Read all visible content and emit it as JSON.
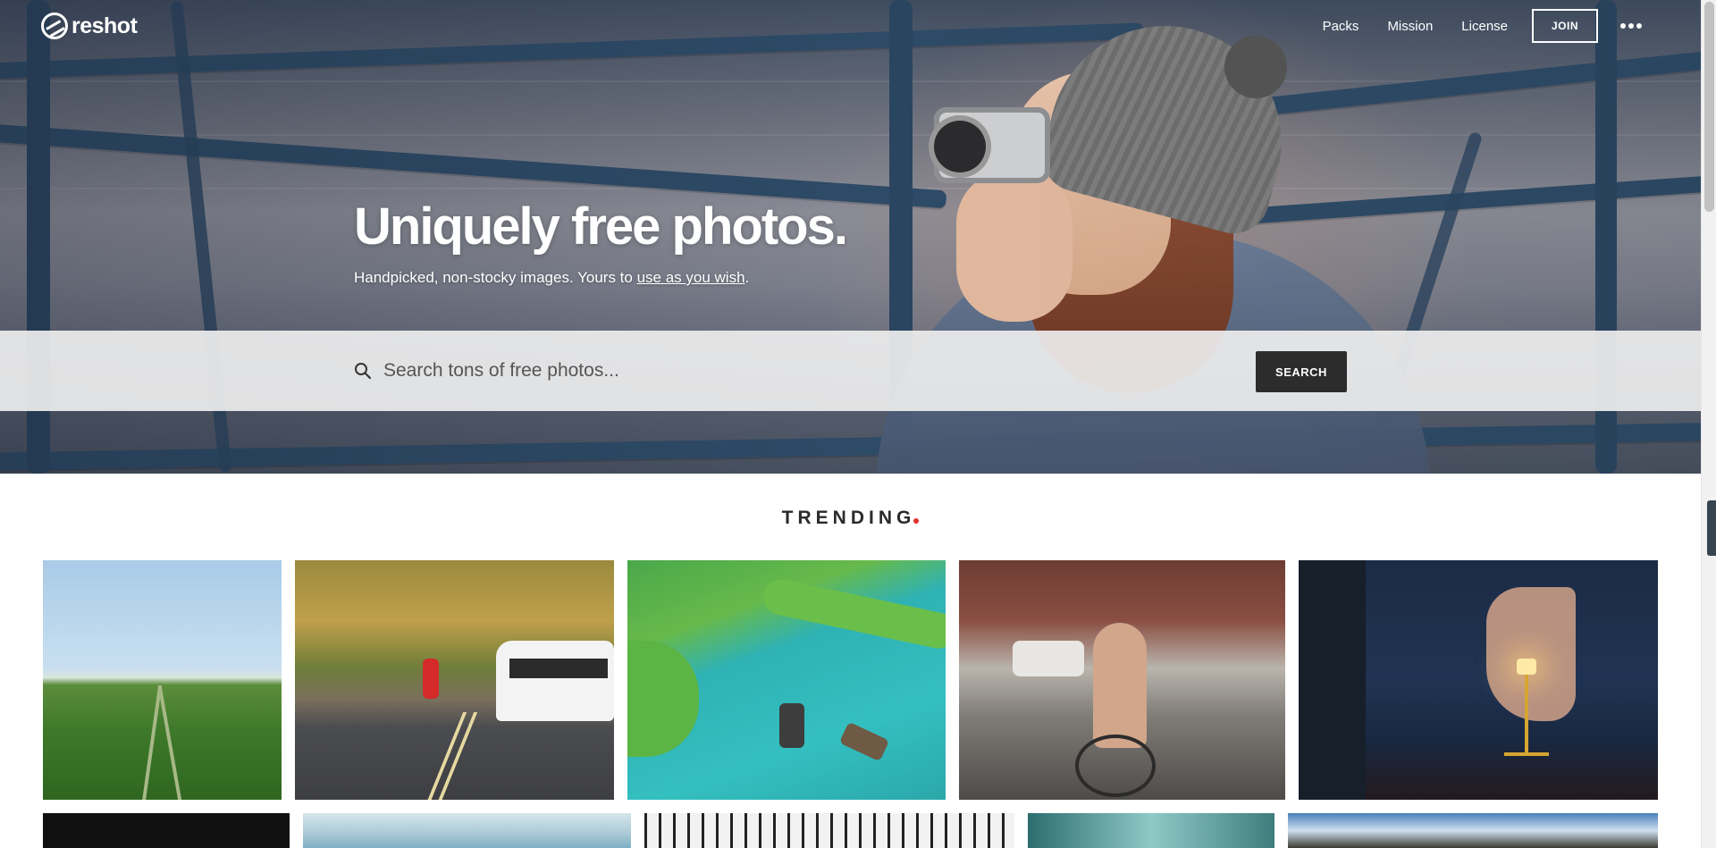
{
  "nav": {
    "logo_text": "reshot",
    "links": [
      "Packs",
      "Mission",
      "License"
    ],
    "join_label": "JOIN"
  },
  "hero": {
    "title": "Uniquely free photos.",
    "subtitle_prefix": "Handpicked, non-stocky images. Yours to ",
    "subtitle_link": "use as you wish",
    "subtitle_suffix": "."
  },
  "search": {
    "placeholder": "Search tons of free photos...",
    "button_label": "SEARCH"
  },
  "trending": {
    "heading": "TRENDING",
    "accent_color": "#e5322d"
  },
  "photos": [
    "wheat-field-photo",
    "road-bus-photo",
    "green-river-boats-photo",
    "street-bike-parade-photo",
    "wall-lamp-photo",
    "dark-photo",
    "mountain-photo",
    "window-grid-photo",
    "teal-photo",
    "sky-cliff-photo"
  ],
  "colors": {
    "search_button_bg": "#2c2c2c",
    "search_band_bg": "#eeeeee"
  }
}
